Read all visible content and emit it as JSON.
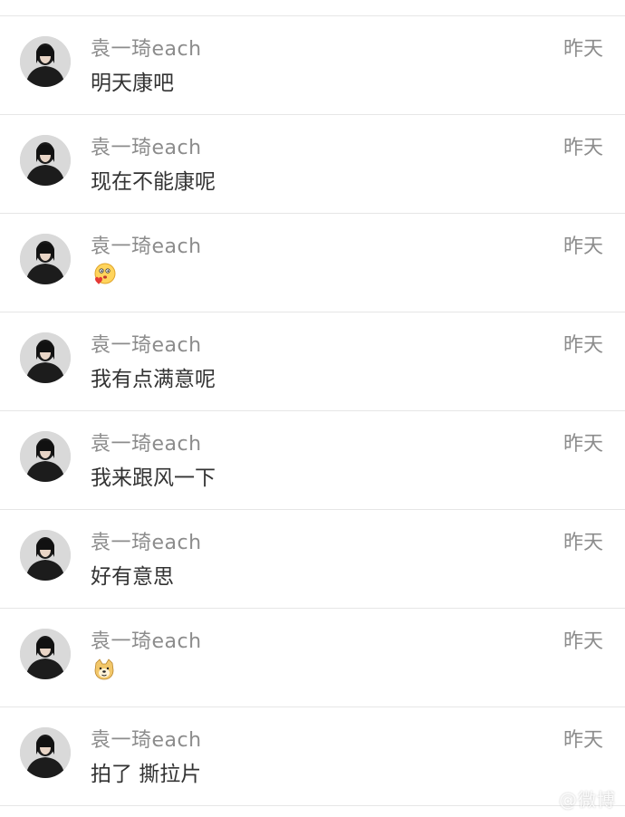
{
  "comments": [
    {
      "user": "袁一琦each",
      "time": "昨天",
      "text": "明天康吧",
      "emoji": null
    },
    {
      "user": "袁一琦each",
      "time": "昨天",
      "text": "现在不能康呢",
      "emoji": null
    },
    {
      "user": "袁一琦each",
      "time": "昨天",
      "text": "",
      "emoji": "kiss-emoji-icon"
    },
    {
      "user": "袁一琦each",
      "time": "昨天",
      "text": "我有点满意呢",
      "emoji": null
    },
    {
      "user": "袁一琦each",
      "time": "昨天",
      "text": "我来跟风一下",
      "emoji": null
    },
    {
      "user": "袁一琦each",
      "time": "昨天",
      "text": "好有意思",
      "emoji": null
    },
    {
      "user": "袁一琦each",
      "time": "昨天",
      "text": "",
      "emoji": "doge-emoji-icon"
    },
    {
      "user": "袁一琦each",
      "time": "昨天",
      "text": "拍了 撕拉片",
      "emoji": null
    }
  ],
  "watermark": "@微博"
}
